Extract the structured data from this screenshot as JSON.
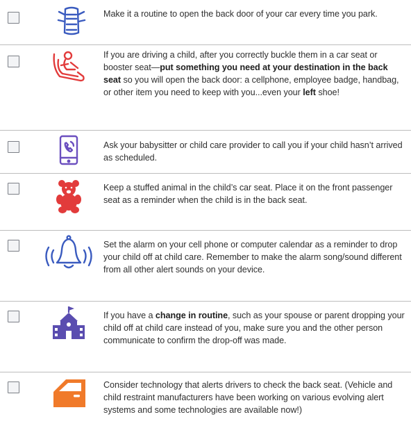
{
  "items": [
    {
      "icon": "car-door-open-icon",
      "color": "#3a5bbf",
      "parts": [
        {
          "text": "Make it a routine to open the back door of your car every time you park.",
          "bold": false
        }
      ]
    },
    {
      "icon": "child-car-seat-icon",
      "color": "#e23b3b",
      "parts": [
        {
          "text": "If you are driving a child, after you correctly buckle them in a car seat or booster seat—",
          "bold": false
        },
        {
          "text": "put something you need at your destination in the back seat",
          "bold": true
        },
        {
          "text": " so you will open the back door: a cellphone, employee badge, handbag, or other item you need to keep with you...even your ",
          "bold": false
        },
        {
          "text": "left",
          "bold": true
        },
        {
          "text": " shoe!",
          "bold": false
        }
      ]
    },
    {
      "icon": "phone-call-icon",
      "color": "#6b4fbf",
      "parts": [
        {
          "text": "Ask your babysitter or child care provider to call you if your child hasn’t arrived as scheduled.",
          "bold": false
        }
      ]
    },
    {
      "icon": "teddy-bear-icon",
      "color": "#e23b3b",
      "parts": [
        {
          "text": "Keep a stuffed animal in the child’s car seat. Place it on the front passenger seat as a reminder when the child is in the back seat.",
          "bold": false
        }
      ]
    },
    {
      "icon": "alarm-bell-icon",
      "color": "#3a5bbf",
      "parts": [
        {
          "text": "Set the alarm on your cell phone or computer calendar as a reminder to drop your child off at child care. Remember to make the alarm song/sound different from all other alert sounds on your device.",
          "bold": false
        }
      ]
    },
    {
      "icon": "school-building-icon",
      "color": "#5a4db0",
      "parts": [
        {
          "text": "If you have a ",
          "bold": false
        },
        {
          "text": "change in routine",
          "bold": true
        },
        {
          "text": ", such as your spouse or parent dropping your child off at child care instead of you, make sure you and the other person communicate to confirm the drop-off was made.",
          "bold": false
        }
      ]
    },
    {
      "icon": "car-door-icon",
      "color": "#f07a2a",
      "parts": [
        {
          "text": "Consider technology that alerts drivers to check the back seat. (Vehicle and child restraint manufacturers have been working on various evolving alert systems and some technologies are available now!)",
          "bold": false
        }
      ]
    }
  ]
}
